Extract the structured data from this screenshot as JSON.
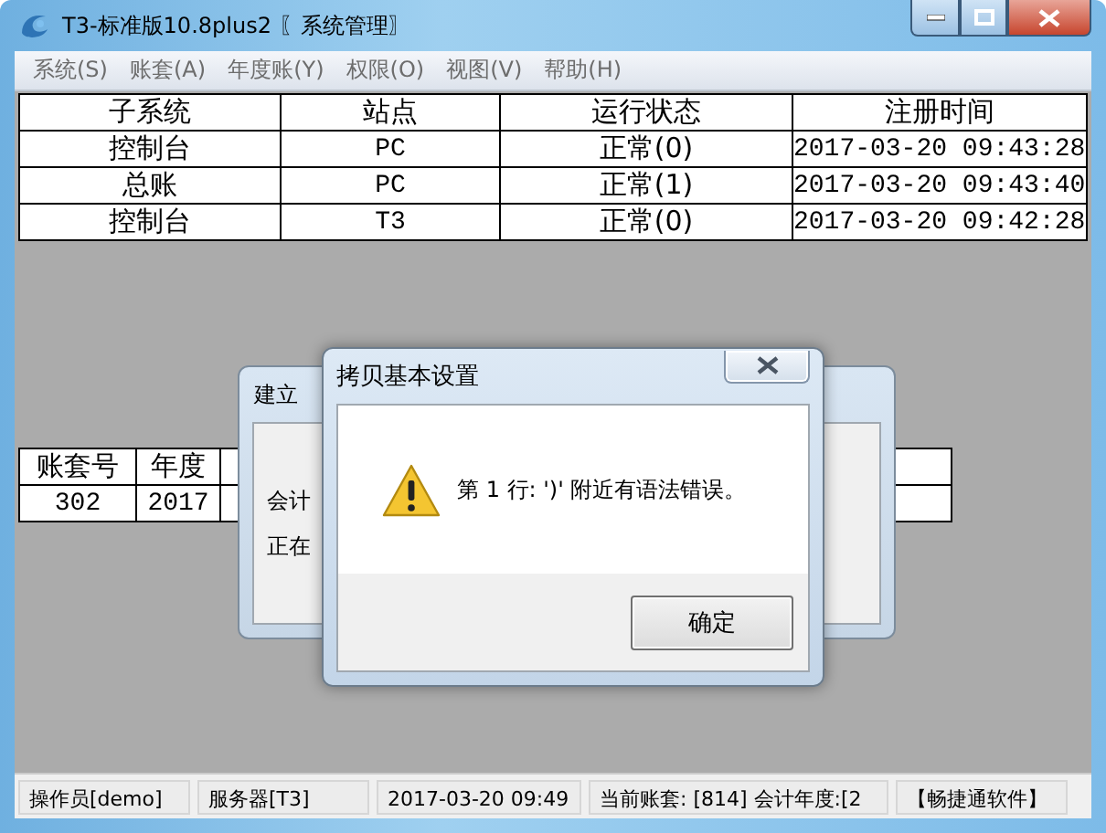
{
  "window": {
    "title": "T3-标准版10.8plus2 〖系统管理〗"
  },
  "menu": [
    "系统(S)",
    "账套(A)",
    "年度账(Y)",
    "权限(O)",
    "视图(V)",
    "帮助(H)"
  ],
  "sessions_table": {
    "columns": [
      "子系统",
      "站点",
      "运行状态",
      "注册时间"
    ],
    "rows": [
      [
        "控制台",
        "PC",
        "正常(0)",
        "2017-03-20 09:43:28"
      ],
      [
        "总账",
        "PC",
        "正常(1)",
        "2017-03-20 09:43:40"
      ],
      [
        "控制台",
        "T3",
        "正常(0)",
        "2017-03-20 09:42:28"
      ]
    ]
  },
  "accounts_table": {
    "columns": [
      "账套号",
      "年度"
    ],
    "rows": [
      [
        "302",
        "2017"
      ]
    ]
  },
  "back_dialog": {
    "title": "建立",
    "lines": [
      "会计",
      "正在"
    ]
  },
  "alert_dialog": {
    "title": "拷贝基本设置",
    "message": "第 1 行: ')' 附近有语法错误。",
    "button": "确定"
  },
  "status_bar": [
    "操作员[demo]",
    "服务器[T3]",
    "2017-03-20 09:49",
    "当前账套: [814] 会计年度:[2",
    "【畅捷通软件】"
  ]
}
